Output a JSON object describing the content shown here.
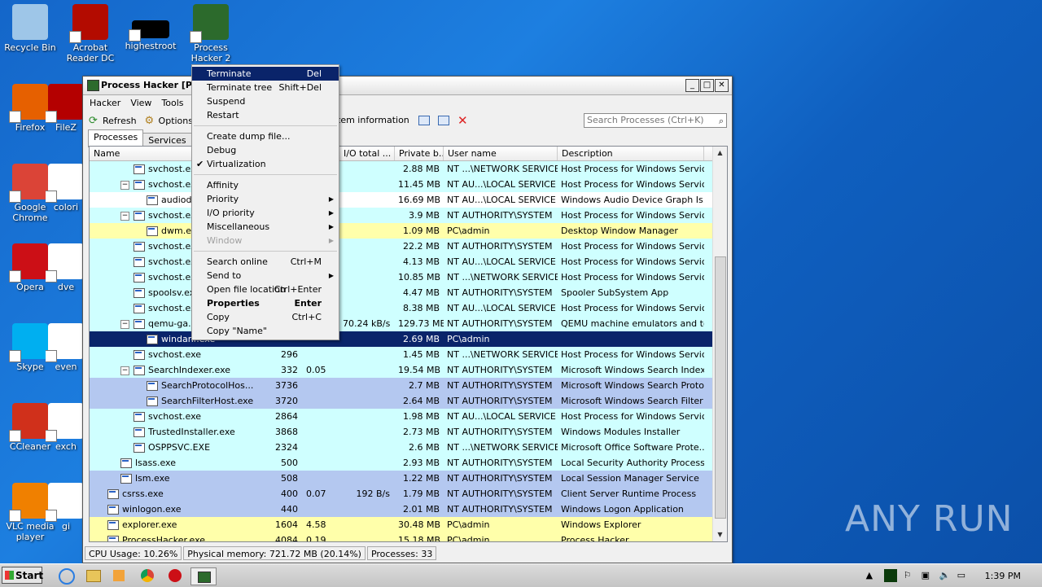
{
  "desktop_icons": [
    {
      "label": "Recycle Bin",
      "icon": "recycle-bin-icon",
      "color": "#9ec6e8"
    },
    {
      "label": "Acrobat Reader DC",
      "icon": "acrobat-icon",
      "color": "#b30b00"
    },
    {
      "label": "highestroot",
      "icon": "black-file-icon",
      "color": "#000000"
    },
    {
      "label": "Process Hacker 2",
      "icon": "process-hacker-icon",
      "color": "#2c6a2c"
    },
    {
      "label": "Firefox",
      "icon": "firefox-icon",
      "color": "#e66000"
    },
    {
      "label": "FileZ",
      "icon": "filezilla-icon",
      "color": "#b40000"
    },
    {
      "label": "Google Chrome",
      "icon": "chrome-icon",
      "color": "#db4437"
    },
    {
      "label": "colori",
      "icon": "file-icon",
      "color": "#ffffff"
    },
    {
      "label": "Opera",
      "icon": "opera-icon",
      "color": "#cc0f16"
    },
    {
      "label": "dve",
      "icon": "file-icon",
      "color": "#ffffff"
    },
    {
      "label": "Skype",
      "icon": "skype-icon",
      "color": "#00aff0"
    },
    {
      "label": "even",
      "icon": "file-icon",
      "color": "#ffffff"
    },
    {
      "label": "CCleaner",
      "icon": "ccleaner-icon",
      "color": "#d0301b"
    },
    {
      "label": "exch",
      "icon": "file-icon",
      "color": "#ffffff"
    },
    {
      "label": "VLC media player",
      "icon": "vlc-icon",
      "color": "#f08000"
    },
    {
      "label": "gi",
      "icon": "file-icon",
      "color": "#ffffff"
    }
  ],
  "window": {
    "title": "Process Hacker [PC",
    "menu": [
      "Hacker",
      "View",
      "Tools",
      "Us"
    ],
    "toolbar": {
      "refresh": "Refresh",
      "options": "Options",
      "sysinfo": "tem information"
    },
    "search_placeholder": "Search Processes (Ctrl+K)",
    "tabs": [
      "Processes",
      "Services",
      "N"
    ],
    "columns": {
      "name": "Name",
      "io": "I/O total ...",
      "private": "Private b...",
      "user": "User name",
      "desc": "Description"
    }
  },
  "rows": [
    {
      "indent": 2,
      "exp": "",
      "name": "svchost.exe",
      "pid": "",
      "cpu": "",
      "io": "",
      "priv": "2.88 MB",
      "user": "NT ...\\NETWORK SERVICE",
      "desc": "Host Process for Windows Services",
      "bg": "#cfffff"
    },
    {
      "indent": 2,
      "exp": "⊟",
      "name": "svchost.exe",
      "pid": "",
      "cpu": "",
      "io": "",
      "priv": "11.45 MB",
      "user": "NT AU...\\LOCAL SERVICE",
      "desc": "Host Process for Windows Services",
      "bg": "#cfffff"
    },
    {
      "indent": 3,
      "exp": "",
      "name": "audiodg.exe",
      "pid": "",
      "cpu": "",
      "io": "",
      "priv": "16.69 MB",
      "user": "NT AU...\\LOCAL SERVICE",
      "desc": "Windows Audio Device Graph Is...",
      "bg": "#ffffff"
    },
    {
      "indent": 2,
      "exp": "⊟",
      "name": "svchost.exe",
      "pid": "",
      "cpu": "",
      "io": "",
      "priv": "3.9 MB",
      "user": "NT AUTHORITY\\SYSTEM",
      "desc": "Host Process for Windows Services",
      "bg": "#cfffff"
    },
    {
      "indent": 3,
      "exp": "",
      "name": "dwm.exe",
      "pid": "",
      "cpu": "",
      "io": "",
      "priv": "1.09 MB",
      "user": "PC\\admin",
      "desc": "Desktop Window Manager",
      "bg": "#ffffaa"
    },
    {
      "indent": 2,
      "exp": "",
      "name": "svchost.exe",
      "pid": "",
      "cpu": "",
      "io": "",
      "priv": "22.2 MB",
      "user": "NT AUTHORITY\\SYSTEM",
      "desc": "Host Process for Windows Services",
      "bg": "#cfffff"
    },
    {
      "indent": 2,
      "exp": "",
      "name": "svchost.exe",
      "pid": "",
      "cpu": "",
      "io": "",
      "priv": "4.13 MB",
      "user": "NT AU...\\LOCAL SERVICE",
      "desc": "Host Process for Windows Services",
      "bg": "#cfffff"
    },
    {
      "indent": 2,
      "exp": "",
      "name": "svchost.exe",
      "pid": "",
      "cpu": "",
      "io": "",
      "priv": "10.85 MB",
      "user": "NT ...\\NETWORK SERVICE",
      "desc": "Host Process for Windows Services",
      "bg": "#cfffff"
    },
    {
      "indent": 2,
      "exp": "",
      "name": "spoolsv.exe",
      "pid": "",
      "cpu": "",
      "io": "",
      "priv": "4.47 MB",
      "user": "NT AUTHORITY\\SYSTEM",
      "desc": "Spooler SubSystem App",
      "bg": "#cfffff"
    },
    {
      "indent": 2,
      "exp": "",
      "name": "svchost.exe",
      "pid": "",
      "cpu": "",
      "io": "",
      "priv": "8.38 MB",
      "user": "NT AU...\\LOCAL SERVICE",
      "desc": "Host Process for Windows Services",
      "bg": "#cfffff"
    },
    {
      "indent": 2,
      "exp": "⊟",
      "name": "qemu-ga.exe",
      "pid": "",
      "cpu": "",
      "io": "70.24 kB/s",
      "priv": "129.73 MB",
      "user": "NT AUTHORITY\\SYSTEM",
      "desc": "QEMU machine emulators and tools",
      "bg": "#cfffff"
    },
    {
      "indent": 3,
      "exp": "",
      "name": "windanr.exe",
      "pid": "",
      "cpu": "",
      "io": "",
      "priv": "2.69 MB",
      "user": "PC\\admin",
      "desc": "",
      "bg": "#0a246a",
      "sel": true
    },
    {
      "indent": 2,
      "exp": "",
      "name": "svchost.exe",
      "pid": "296",
      "cpu": "",
      "io": "",
      "priv": "1.45 MB",
      "user": "NT ...\\NETWORK SERVICE",
      "desc": "Host Process for Windows Services",
      "bg": "#cfffff"
    },
    {
      "indent": 2,
      "exp": "⊟",
      "name": "SearchIndexer.exe",
      "pid": "332",
      "cpu": "0.05",
      "io": "",
      "priv": "19.54 MB",
      "user": "NT AUTHORITY\\SYSTEM",
      "desc": "Microsoft Windows Search Indexer",
      "bg": "#cfffff"
    },
    {
      "indent": 3,
      "exp": "",
      "name": "SearchProtocolHos...",
      "pid": "3736",
      "cpu": "",
      "io": "",
      "priv": "2.7 MB",
      "user": "NT AUTHORITY\\SYSTEM",
      "desc": "Microsoft Windows Search Proto...",
      "bg": "#b4c8f0"
    },
    {
      "indent": 3,
      "exp": "",
      "name": "SearchFilterHost.exe",
      "pid": "3720",
      "cpu": "",
      "io": "",
      "priv": "2.64 MB",
      "user": "NT AUTHORITY\\SYSTEM",
      "desc": "Microsoft Windows Search Filter ...",
      "bg": "#b4c8f0"
    },
    {
      "indent": 2,
      "exp": "",
      "name": "svchost.exe",
      "pid": "2864",
      "cpu": "",
      "io": "",
      "priv": "1.98 MB",
      "user": "NT AU...\\LOCAL SERVICE",
      "desc": "Host Process for Windows Services",
      "bg": "#cfffff"
    },
    {
      "indent": 2,
      "exp": "",
      "name": "TrustedInstaller.exe",
      "pid": "3868",
      "cpu": "",
      "io": "",
      "priv": "2.73 MB",
      "user": "NT AUTHORITY\\SYSTEM",
      "desc": "Windows Modules Installer",
      "bg": "#cfffff"
    },
    {
      "indent": 2,
      "exp": "",
      "name": "OSPPSVC.EXE",
      "pid": "2324",
      "cpu": "",
      "io": "",
      "priv": "2.6 MB",
      "user": "NT ...\\NETWORK SERVICE",
      "desc": "Microsoft Office Software Prote...",
      "bg": "#cfffff"
    },
    {
      "indent": 1,
      "exp": "",
      "name": "lsass.exe",
      "pid": "500",
      "cpu": "",
      "io": "",
      "priv": "2.93 MB",
      "user": "NT AUTHORITY\\SYSTEM",
      "desc": "Local Security Authority Process",
      "bg": "#cfffff"
    },
    {
      "indent": 1,
      "exp": "",
      "name": "lsm.exe",
      "pid": "508",
      "cpu": "",
      "io": "",
      "priv": "1.22 MB",
      "user": "NT AUTHORITY\\SYSTEM",
      "desc": "Local Session Manager Service",
      "bg": "#b4c8f0"
    },
    {
      "indent": 0,
      "exp": "",
      "name": "csrss.exe",
      "pid": "400",
      "cpu": "0.07",
      "io": "192 B/s",
      "priv": "1.79 MB",
      "user": "NT AUTHORITY\\SYSTEM",
      "desc": "Client Server Runtime Process",
      "bg": "#b4c8f0"
    },
    {
      "indent": 0,
      "exp": "",
      "name": "winlogon.exe",
      "pid": "440",
      "cpu": "",
      "io": "",
      "priv": "2.01 MB",
      "user": "NT AUTHORITY\\SYSTEM",
      "desc": "Windows Logon Application",
      "bg": "#b4c8f0"
    },
    {
      "indent": 0,
      "exp": "",
      "name": "explorer.exe",
      "pid": "1604",
      "cpu": "4.58",
      "io": "",
      "priv": "30.48 MB",
      "user": "PC\\admin",
      "desc": "Windows Explorer",
      "bg": "#ffffaa"
    },
    {
      "indent": 0,
      "exp": "",
      "name": "ProcessHacker.exe",
      "pid": "4084",
      "cpu": "0.19",
      "io": "",
      "priv": "15.18 MB",
      "user": "PC\\admin",
      "desc": "Process Hacker",
      "bg": "#ffffaa"
    }
  ],
  "status": {
    "cpu": "CPU Usage: 10.26%",
    "mem": "Physical memory: 721.72 MB (20.14%)",
    "procs": "Processes: 33"
  },
  "context_menu": [
    {
      "label": "Terminate",
      "shortcut": "Del",
      "hl": true
    },
    {
      "label": "Terminate tree",
      "shortcut": "Shift+Del"
    },
    {
      "label": "Suspend"
    },
    {
      "label": "Restart"
    },
    {
      "sep": true
    },
    {
      "label": "Create dump file..."
    },
    {
      "label": "Debug"
    },
    {
      "label": "Virtualization",
      "check": true
    },
    {
      "sep": true
    },
    {
      "label": "Affinity"
    },
    {
      "label": "Priority",
      "sub": true
    },
    {
      "label": "I/O priority",
      "sub": true
    },
    {
      "label": "Miscellaneous",
      "sub": true
    },
    {
      "label": "Window",
      "sub": true,
      "dis": true
    },
    {
      "sep": true
    },
    {
      "label": "Search online",
      "shortcut": "Ctrl+M"
    },
    {
      "label": "Send to",
      "sub": true
    },
    {
      "label": "Open file location",
      "shortcut": "Ctrl+Enter"
    },
    {
      "label": "Properties",
      "shortcut": "Enter",
      "bold": true
    },
    {
      "label": "Copy",
      "shortcut": "Ctrl+C"
    },
    {
      "label": "Copy \"Name\""
    }
  ],
  "taskbar": {
    "start": "Start",
    "clock": "1:39 PM"
  },
  "watermark": "ANY RUN"
}
